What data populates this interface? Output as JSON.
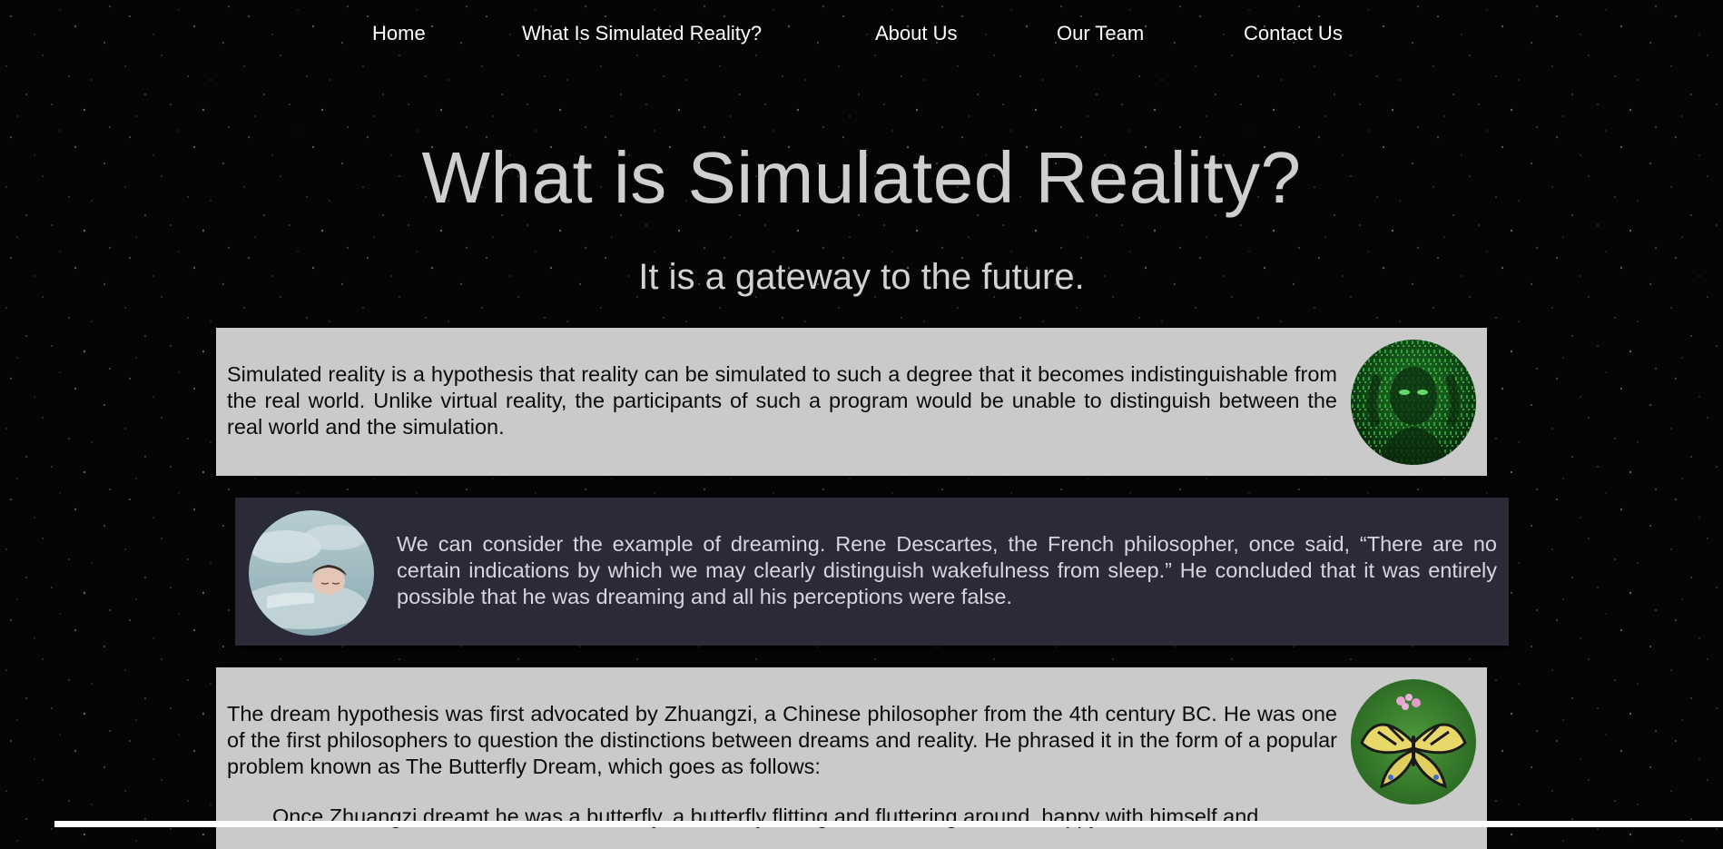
{
  "nav": {
    "items": [
      {
        "label": "Home"
      },
      {
        "label": "What Is Simulated Reality?"
      },
      {
        "label": "About Us"
      },
      {
        "label": "Our Team"
      },
      {
        "label": "Contact Us"
      }
    ]
  },
  "hero": {
    "title": "What is Simulated Reality?",
    "subtitle": "It is a gateway to the future."
  },
  "sections": [
    {
      "text": "Simulated reality is a hypothesis that reality can be simulated to such a degree that it becomes indistinguishable from the real world. Unlike virtual reality, the participants of such a program would be unable to distinguish between the real world and the simulation.",
      "image": "matrix-face-image"
    },
    {
      "text": "We can consider the example of dreaming. Rene Descartes, the French philosopher, once said, “There are no certain indications by which we may clearly distinguish wakefulness from sleep.” He concluded that it was entirely possible that he was dreaming and all his perceptions were false.",
      "image": "sleeping-woman-image"
    },
    {
      "text": "The dream hypothesis was first advocated by Zhuangzi, a Chinese philosopher from the 4th century BC. He was one of the first philosophers to question the distinctions between dreams and reality. He phrased it in the form of a popular problem known as The Butterfly Dream, which goes as follows:",
      "quote": "Once Zhuangzi dreamt he was a butterfly, a butterfly flitting and fluttering around, happy with himself and",
      "image": "butterfly-image"
    }
  ],
  "colors": {
    "background": "#050505",
    "light_panel": "#cacaca",
    "dark_panel": "#2a2a38",
    "title_text": "#cfcfcf"
  }
}
